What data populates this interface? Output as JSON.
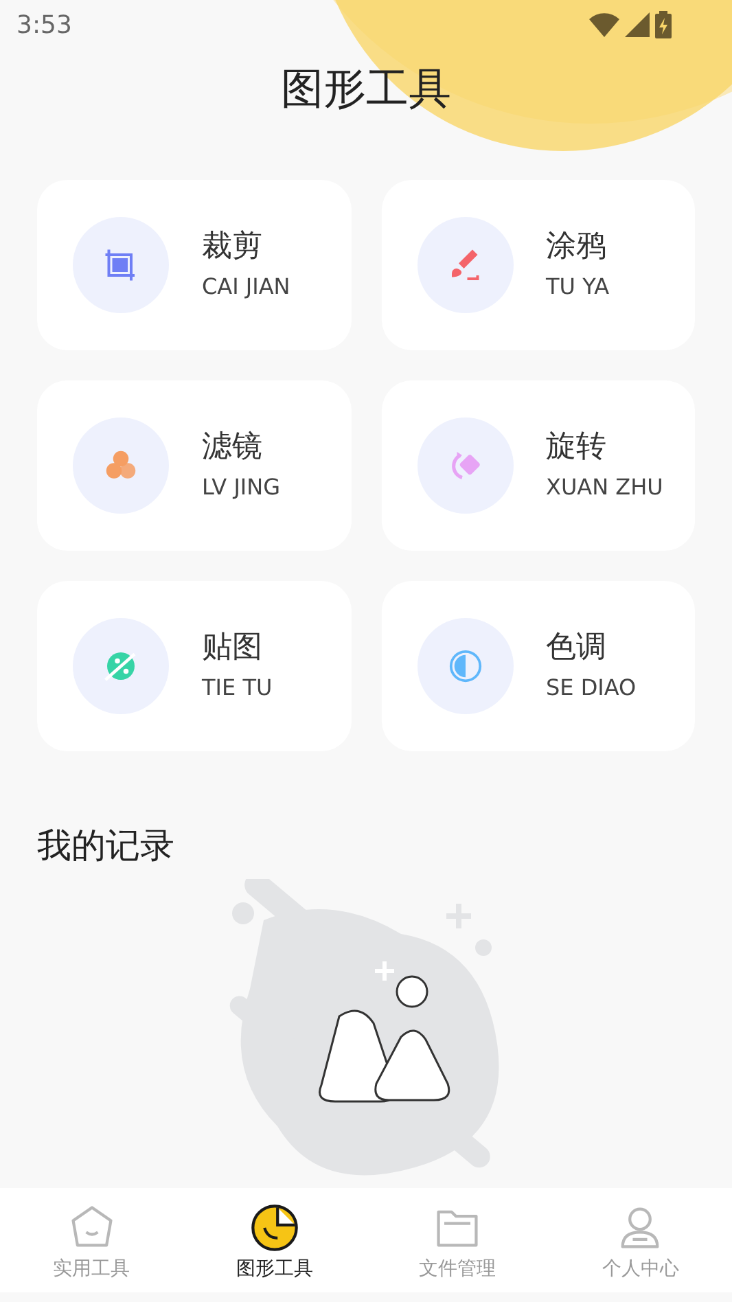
{
  "status_bar": {
    "time": "3:53"
  },
  "header": {
    "title": "图形工具"
  },
  "tools": [
    {
      "kind": "crop",
      "title": "裁剪",
      "subtitle": "CAI JIAN",
      "color": "#6f7ff5"
    },
    {
      "kind": "brush",
      "title": "涂鸦",
      "subtitle": "TU YA",
      "color": "#f4646a"
    },
    {
      "kind": "filter",
      "title": "滤镜",
      "subtitle": "LV JING",
      "color": "#f59e63"
    },
    {
      "kind": "rotate",
      "title": "旋转",
      "subtitle": "XUAN ZHU",
      "color": "#e7a4f5"
    },
    {
      "kind": "sticker",
      "title": "贴图",
      "subtitle": "TIE TU",
      "color": "#36d4a6"
    },
    {
      "kind": "tone",
      "title": "色调",
      "subtitle": "SE DIAO",
      "color": "#5fb7fb"
    }
  ],
  "records": {
    "title": "我的记录"
  },
  "bottom_nav": [
    {
      "kind": "home",
      "label": "实用工具",
      "selected": false
    },
    {
      "kind": "chart",
      "label": "图形工具",
      "selected": true
    },
    {
      "kind": "folder",
      "label": "文件管理",
      "selected": false
    },
    {
      "kind": "person",
      "label": "个人中心",
      "selected": false
    }
  ]
}
